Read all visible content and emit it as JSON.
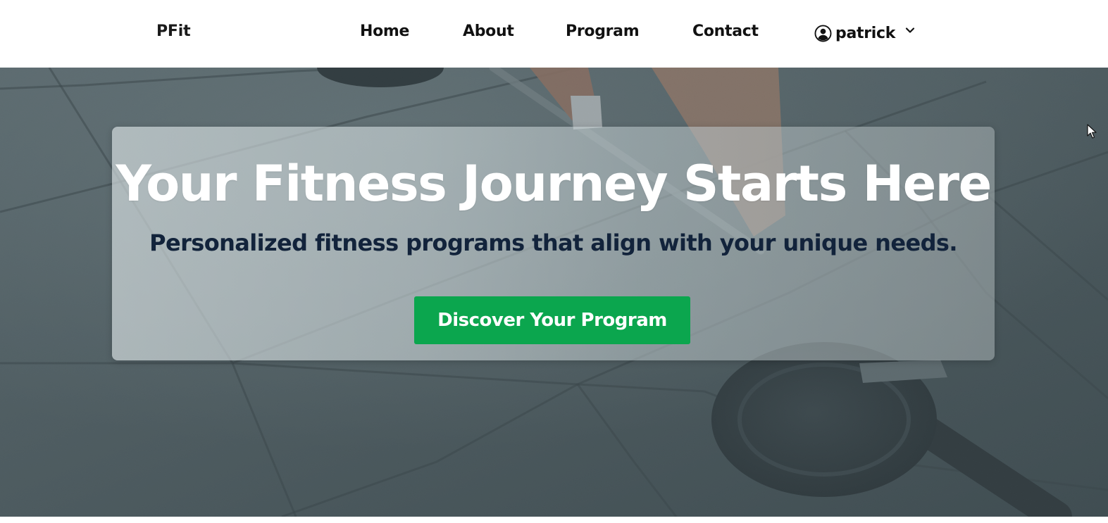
{
  "header": {
    "brand": "PFit",
    "nav": {
      "home": "Home",
      "about": "About",
      "program": "Program",
      "contact": "Contact"
    },
    "user": {
      "name": "patrick",
      "icon": "user-circle-icon",
      "menu_icon": "chevron-down-icon"
    }
  },
  "hero": {
    "title": "Your Fitness Journey Starts Here",
    "subtitle": "Personalized fitness programs that align with your unique needs.",
    "cta_label": "Discover Your Program",
    "background": "gym-floor-barbell-photo"
  },
  "colors": {
    "cta": "#0ba64e",
    "subtitle": "#12233b",
    "title": "#ffffff",
    "nav_text": "#111111"
  }
}
